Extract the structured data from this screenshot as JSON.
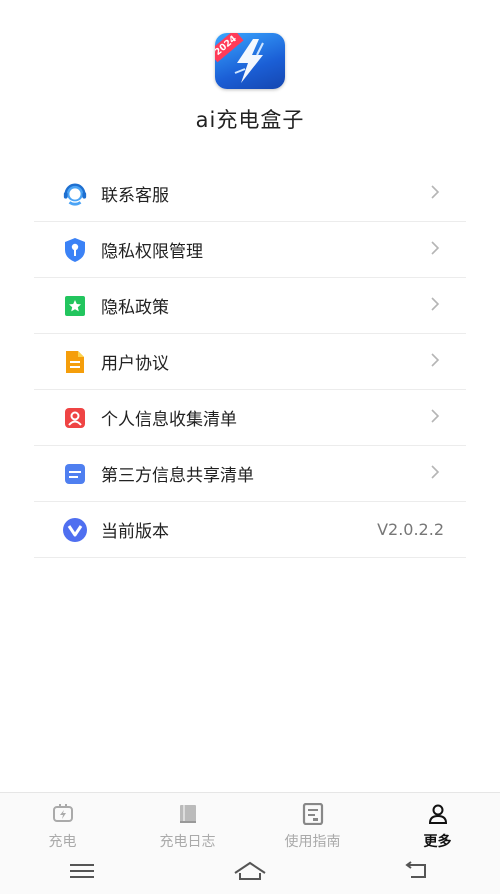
{
  "app": {
    "name": "ai充电盒子",
    "icon_badge": "2024",
    "icon_name": "lightning-app-icon"
  },
  "menu": {
    "items": [
      {
        "label": "联系客服",
        "icon": "customer-service-icon"
      },
      {
        "label": "隐私权限管理",
        "icon": "shield-key-icon"
      },
      {
        "label": "隐私政策",
        "icon": "star-bookmark-icon"
      },
      {
        "label": "用户协议",
        "icon": "document-icon"
      },
      {
        "label": "个人信息收集清单",
        "icon": "person-card-icon"
      },
      {
        "label": "第三方信息共享清单",
        "icon": "list-doc-icon"
      },
      {
        "label": "当前版本",
        "icon": "version-v-icon"
      }
    ],
    "version": "V2.0.2.2"
  },
  "tabbar": {
    "tabs": [
      {
        "label": "充电",
        "icon": "charging-icon",
        "active": false
      },
      {
        "label": "充电日志",
        "icon": "book-icon",
        "active": false
      },
      {
        "label": "使用指南",
        "icon": "guide-icon",
        "active": false
      },
      {
        "label": "更多",
        "icon": "person-icon",
        "active": true
      }
    ]
  },
  "colors": {
    "accent_blue": "#3b82f6",
    "orange": "#f59e0b",
    "red": "#ef4444",
    "green": "#22c55e",
    "inactive_tab": "#aaaaaa"
  }
}
